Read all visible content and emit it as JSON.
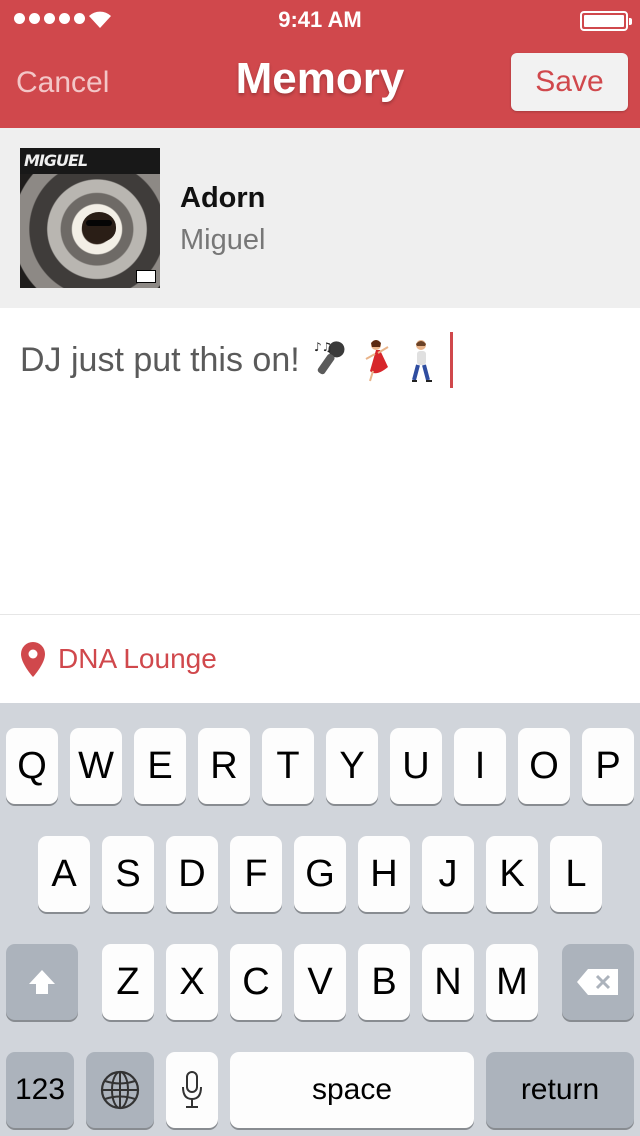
{
  "status_bar": {
    "time": "9:41 AM",
    "signal_icon": "signal-dots-icon",
    "wifi_icon": "wifi-icon",
    "battery_icon": "battery-icon",
    "battery_level": 1.0
  },
  "nav": {
    "cancel_label": "Cancel",
    "title": "Memory",
    "save_label": "Save"
  },
  "song": {
    "album_art_icon": "album-art",
    "album_logo_text": "MIGUEL",
    "title": "Adorn",
    "artist": "Miguel"
  },
  "memory": {
    "text": "DJ just put this on!",
    "emojis": [
      "microphone-emoji",
      "dancer-emoji",
      "walking-man-emoji"
    ]
  },
  "location": {
    "icon": "location-pin-icon",
    "label": "DNA Lounge"
  },
  "keyboard": {
    "row1": [
      "Q",
      "W",
      "E",
      "R",
      "T",
      "Y",
      "U",
      "I",
      "O",
      "P"
    ],
    "row2": [
      "A",
      "S",
      "D",
      "F",
      "G",
      "H",
      "J",
      "K",
      "L"
    ],
    "row3": [
      "Z",
      "X",
      "C",
      "V",
      "B",
      "N",
      "M"
    ],
    "shift_icon": "shift-arrow-icon",
    "backspace_icon": "backspace-icon",
    "numbers_label": "123",
    "globe_icon": "globe-icon",
    "mic_icon": "microphone-icon",
    "space_label": "space",
    "return_label": "return"
  },
  "colors": {
    "accent": "#d0484c",
    "keyboard_bg": "#d1d5db",
    "key_dark": "#acb3bc"
  }
}
